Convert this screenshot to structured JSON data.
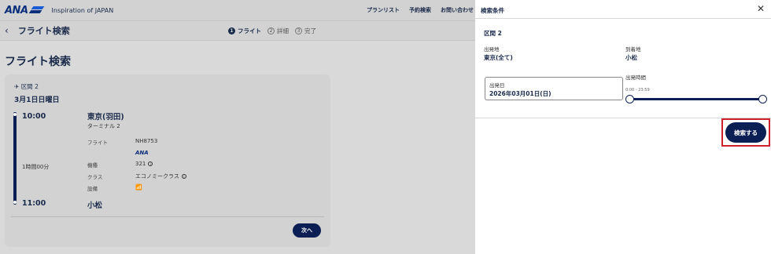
{
  "header": {
    "logo_text": "ANA",
    "tagline": "Inspiration of JAPAN",
    "nav": [
      "プランリスト",
      "予約検索",
      "お問い合わせ"
    ]
  },
  "subheader": {
    "title": "フライト検索",
    "steps": [
      {
        "num": "1",
        "label": "フライト"
      },
      {
        "num": "2",
        "label": "詳細"
      },
      {
        "num": "3",
        "label": "完了"
      }
    ]
  },
  "main": {
    "title": "フライト検索",
    "card": {
      "segment": "区間 2",
      "date": "3月1日日曜日",
      "departure_time": "10:00",
      "arrival_time": "11:00",
      "duration": "1時間00分",
      "departure_airport": "東京(羽田)",
      "terminal": "ターミナル 2",
      "arrival_airport": "小松",
      "flight_label": "フライト",
      "flight_value": "NH8753",
      "operator_logo": "ANA",
      "aircraft_label": "機種",
      "aircraft_value": "321",
      "class_label": "クラス",
      "class_value": "エコノミークラス",
      "equipment_label": "設備",
      "wifi_icon": "wifi-icon",
      "next_button": "次へ"
    }
  },
  "panel": {
    "title": "検索条件",
    "close_icon": "close-icon",
    "segment": "区間 2",
    "from_label": "出発地",
    "from_value": "東京(全て)",
    "to_label": "到着地",
    "to_value": "小松",
    "date_label": "出発日",
    "date_value": "2026年03月01日(日)",
    "time_label": "出発時間",
    "time_range": "0:00 - 23:59",
    "search_button": "検索する"
  },
  "colors": {
    "navy": "#0b1f55",
    "brand_blue": "#1c5bd6",
    "highlight_red": "#d0202b"
  }
}
